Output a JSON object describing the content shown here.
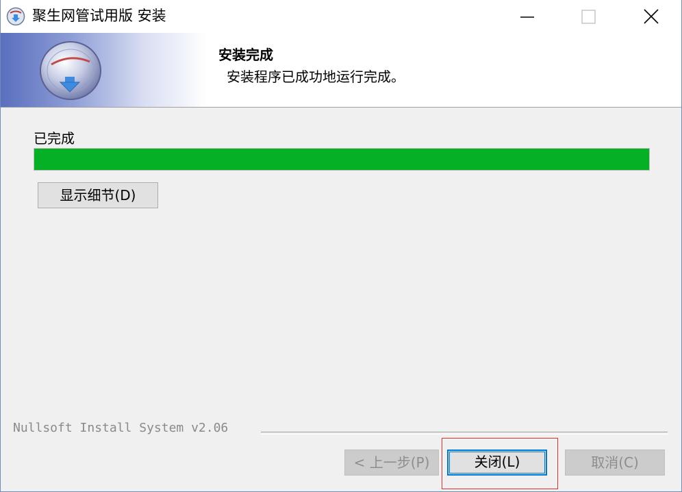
{
  "window": {
    "title": "聚生网管试用版 安装",
    "icon": "installer-app-icon"
  },
  "titlebar_buttons": {
    "minimize_icon": "minimize-icon",
    "maximize_icon": "maximize-icon",
    "close_icon": "close-icon"
  },
  "header": {
    "title": "安装完成",
    "subtitle": "安装程序已成功地运行完成。",
    "logo_icon": "installer-disc-logo"
  },
  "body": {
    "status_label": "已完成",
    "progress_fraction": 1.0,
    "progress_color": "#06b025",
    "details_button": "显示细节(D)"
  },
  "footer": {
    "branding": "Nullsoft Install System v2.06",
    "back_button": "< 上一步(P)",
    "close_button": "关闭(L)",
    "cancel_button": "取消(C)"
  },
  "colors": {
    "focus_border": "#0078d7",
    "highlight_box": "#e03030"
  }
}
